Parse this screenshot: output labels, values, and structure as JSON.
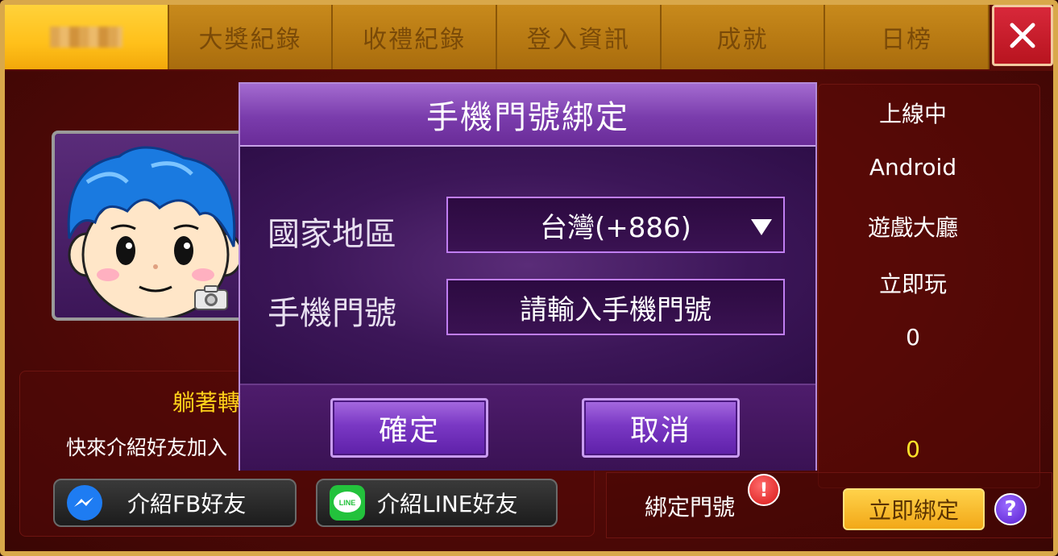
{
  "tabs": [
    {
      "label": "",
      "active": true,
      "note": "pixelated"
    },
    {
      "label": "大獎紀錄"
    },
    {
      "label": "收禮紀錄"
    },
    {
      "label": "登入資訊"
    },
    {
      "label": "成就"
    },
    {
      "label": "日榜"
    }
  ],
  "close_icon": "close-icon",
  "profile": {
    "camera_icon": "camera-icon"
  },
  "invite": {
    "title": "躺著轉",
    "subtitle": "快來介紹好友加入",
    "fb_button": "介紹FB好友",
    "line_button": "介紹LINE好友",
    "line_icon_text": "LINE"
  },
  "info": {
    "status": "上線中",
    "platform": "Android",
    "location": "遊戲大廳",
    "mode": "立即玩",
    "count": "0",
    "gold_count": "0"
  },
  "bind": {
    "label": "綁定門號",
    "alert": "!",
    "bind_now": "立即綁定",
    "help": "?"
  },
  "modal": {
    "title": "手機門號綁定",
    "country_label": "國家地區",
    "country_value": "台灣(+886)",
    "phone_label": "手機門號",
    "phone_placeholder": "請輸入手機門號",
    "confirm": "確定",
    "cancel": "取消"
  },
  "colors": {
    "tab_active": "#ffc01a",
    "tab": "#b67812",
    "close": "#c81e2c",
    "modal_header": "#7a3cac",
    "gold_text": "#ffe22a"
  }
}
